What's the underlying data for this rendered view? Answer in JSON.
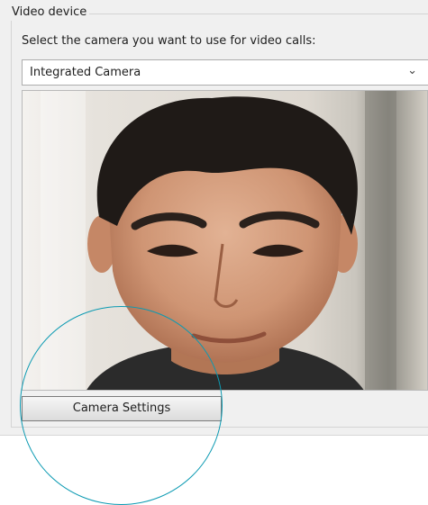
{
  "video_device": {
    "group_title": "Video device",
    "prompt": "Select the camera you want to use for video calls:",
    "camera_select": {
      "selected": "Integrated Camera",
      "arrow_icon": "chevron-down-icon"
    },
    "preview": {
      "content": "camera-preview-image"
    },
    "camera_settings_label": "Camera Settings"
  },
  "colors": {
    "panel_bg": "#f0f0f0",
    "highlight_ring": "#0b9ab2",
    "button_border": "#7a7a7a"
  }
}
